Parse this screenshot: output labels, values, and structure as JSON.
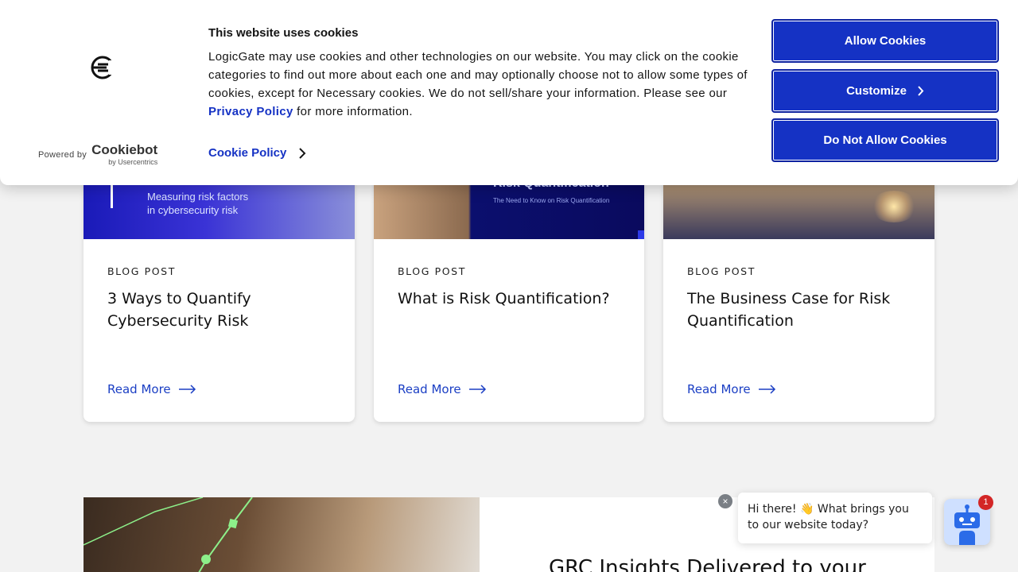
{
  "cards": [
    {
      "kind": "BLOG POST",
      "title_line1": "3 Ways to Quantify",
      "title_line2": "Cybersecurity Risk",
      "link": "Read More",
      "thumb_line1": "Measuring risk factors",
      "thumb_line2": "in cybersecurity risk"
    },
    {
      "kind": "BLOG POST",
      "title_line1": "What is Risk Quantification?",
      "title_line2": "",
      "link": "Read More",
      "thumb_line1": "Risk Quantification",
      "thumb_line2": "The Need to Know on Risk Quantification"
    },
    {
      "kind": "BLOG POST",
      "title_line1": "The Business Case for Risk",
      "title_line2": "Quantification",
      "link": "Read More"
    }
  ],
  "banner": {
    "heading": "GRC Insights Delivered to your"
  },
  "cookie": {
    "title": "This website uses cookies",
    "text_before_link": "LogicGate may use cookies and other technologies on our website. You may click on the cookie categories to find out more about each one and may optionally choose not to allow some types of cookies, except for Necessary cookies.  We do not sell/share your information. Please see our ",
    "privacy_link": "Privacy Policy",
    "text_after_link": " for more information.",
    "policy_link": "Cookie Policy",
    "powered_by": "Powered by",
    "cookiebot": "Cookiebot",
    "usercentrics": "by Usercentrics",
    "buttons": {
      "allow": "Allow Cookies",
      "customize": "Customize",
      "deny": "Do Not Allow Cookies"
    }
  },
  "chat": {
    "message": "Hi there! 👋 What brings you to our website today?",
    "badge": "1",
    "close": "×"
  }
}
